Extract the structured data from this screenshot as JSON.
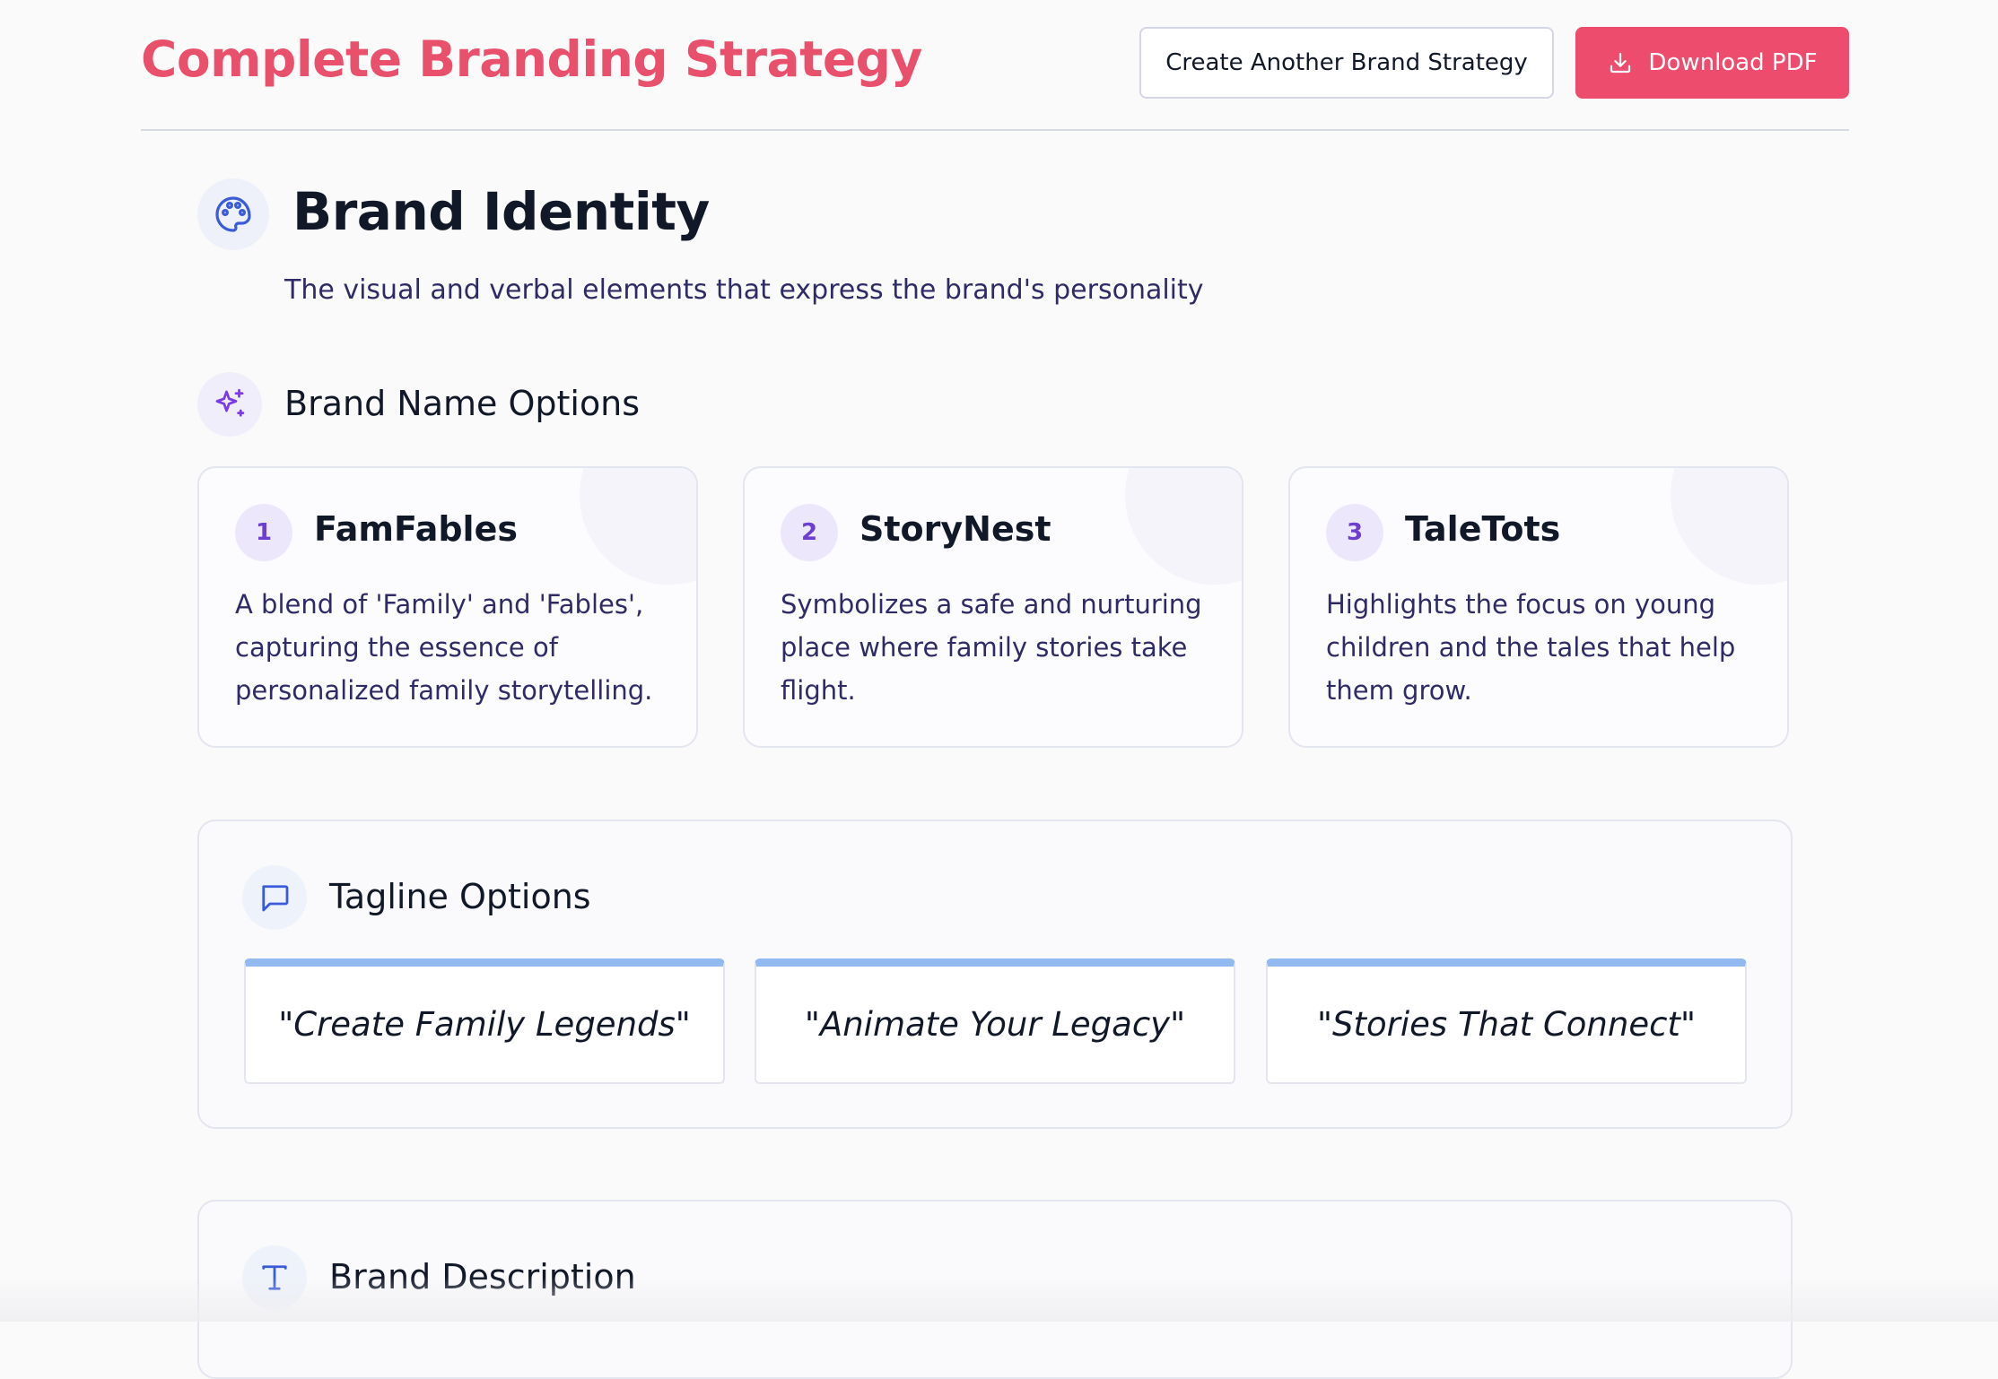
{
  "header": {
    "title": "Complete Branding Strategy",
    "create_another_label": "Create Another Brand Strategy",
    "download_label": "Download PDF"
  },
  "brand_identity": {
    "title": "Brand Identity",
    "subtitle": "The visual and verbal elements that express the brand's personality",
    "icon": "palette-icon"
  },
  "brand_names": {
    "title": "Brand Name Options",
    "icon": "sparkles-icon",
    "items": [
      {
        "number": "1",
        "name": "FamFables",
        "description": "A blend of 'Family' and 'Fables', capturing the essence of personalized family storytelling."
      },
      {
        "number": "2",
        "name": "StoryNest",
        "description": "Symbolizes a safe and nurturing place where family stories take flight."
      },
      {
        "number": "3",
        "name": "TaleTots",
        "description": "Highlights the focus on young children and the tales that help them grow."
      }
    ]
  },
  "taglines": {
    "title": "Tagline Options",
    "icon": "message-square-icon",
    "items": [
      {
        "text": "\"Create Family Legends\""
      },
      {
        "text": "\"Animate Your Legacy\""
      },
      {
        "text": "\"Stories That Connect\""
      }
    ]
  },
  "brand_description": {
    "title": "Brand Description",
    "icon": "type-icon"
  },
  "colors": {
    "accent": "#e8506c",
    "primary_button": "#ee4c6c",
    "purple": "#6d3fd1",
    "blue_icon": "#3b5bdb",
    "tagline_bar": "#93b9f1",
    "body_text": "#2f2b66"
  }
}
